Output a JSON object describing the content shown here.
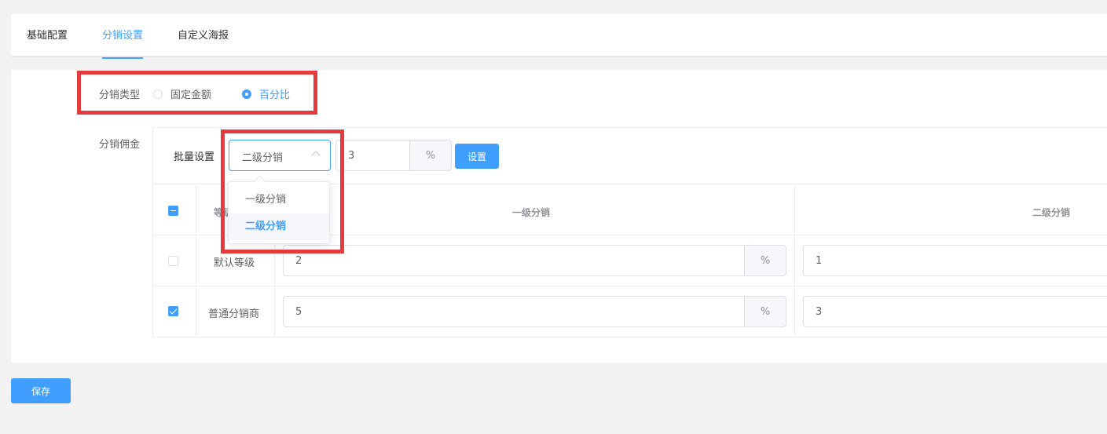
{
  "tabs": [
    {
      "label": "基础配置",
      "active": false
    },
    {
      "label": "分销设置",
      "active": true
    },
    {
      "label": "自定义海报",
      "active": false
    }
  ],
  "distribution_type": {
    "label": "分销类型",
    "options": [
      {
        "label": "固定金额",
        "checked": false
      },
      {
        "label": "百分比",
        "checked": true
      }
    ]
  },
  "commission": {
    "label": "分销佣金",
    "batch": {
      "label": "批量设置",
      "selected_level": "二级分销",
      "value": "3",
      "unit": "%",
      "set_button": "设置"
    },
    "dropdown": {
      "options": [
        {
          "label": "一级分销",
          "selected": false
        },
        {
          "label": "二级分销",
          "selected": true
        }
      ]
    },
    "table": {
      "headers": {
        "level": "等级",
        "first": "一级分销",
        "second": "二级分销"
      },
      "header_checkbox": "indeterminate",
      "rows": [
        {
          "checked": false,
          "level": "默认等级",
          "first": "2",
          "first_unit": "%",
          "second": "1"
        },
        {
          "checked": true,
          "level": "普通分销商",
          "first": "5",
          "first_unit": "%",
          "second": "3"
        }
      ]
    }
  },
  "save_button": "保存",
  "colors": {
    "accent": "#409eff",
    "highlight_box": "#e43c3c"
  }
}
